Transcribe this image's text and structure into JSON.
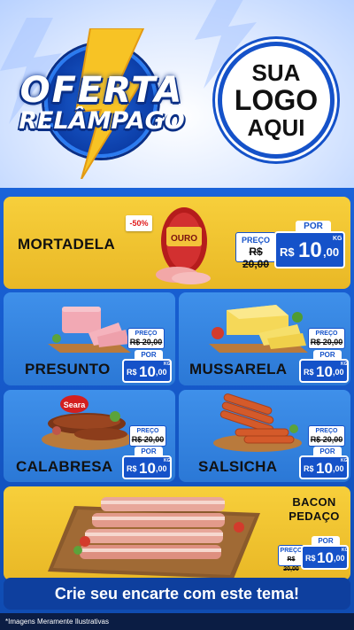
{
  "header": {
    "title_line1": "OFERTA",
    "title_line2": "RELÂMPAGO",
    "logo_line1": "SUA",
    "logo_line2": "LOGO",
    "logo_line3": "AQUI"
  },
  "products": {
    "mortadela": {
      "name": "MORTADELA",
      "discount": "-50%",
      "brand": "OURO",
      "old_label": "PREÇO",
      "old_price": "R$ 20,00",
      "por": "POR",
      "currency": "R$",
      "price_int": "10",
      "price_dec": ",00",
      "unit": "KG"
    },
    "presunto": {
      "name": "PRESUNTO",
      "old_label": "PREÇO",
      "old_price": "R$ 20,00",
      "por": "POR",
      "currency": "R$",
      "price_int": "10",
      "price_dec": ",00",
      "unit": "KG"
    },
    "mussarela": {
      "name": "MUSSARELA",
      "old_label": "PREÇO",
      "old_price": "R$ 20,00",
      "por": "POR",
      "currency": "R$",
      "price_int": "10",
      "price_dec": ",00",
      "unit": "KG"
    },
    "calabresa": {
      "name": "CALABRESA",
      "brand": "Seara",
      "old_label": "PREÇO",
      "old_price": "R$ 20,00",
      "por": "POR",
      "currency": "R$",
      "price_int": "10",
      "price_dec": ",00",
      "unit": "KG"
    },
    "salsicha": {
      "name": "SALSICHA",
      "old_label": "PREÇO",
      "old_price": "R$ 20,00",
      "por": "POR",
      "currency": "R$",
      "price_int": "10",
      "price_dec": ",00",
      "unit": "KG"
    },
    "bacon": {
      "name_line1": "BACON",
      "name_line2": "PEDAÇO",
      "old_label": "PREÇO",
      "old_price": "R$ 20,00",
      "por": "POR",
      "currency": "R$",
      "price_int": "10",
      "price_dec": ",00",
      "unit": "KG"
    }
  },
  "banner": {
    "text": "Crie seu encarte com este tema!"
  },
  "disclaimer": "*Imagens Meramente Ilustrativas",
  "colors": {
    "brand_blue": "#1552c9",
    "card_yellow": "#f7cf3b",
    "card_blue": "#3f90ea"
  },
  "icons": [
    "lightning-bolt-icon",
    "logo-placeholder-circle"
  ]
}
